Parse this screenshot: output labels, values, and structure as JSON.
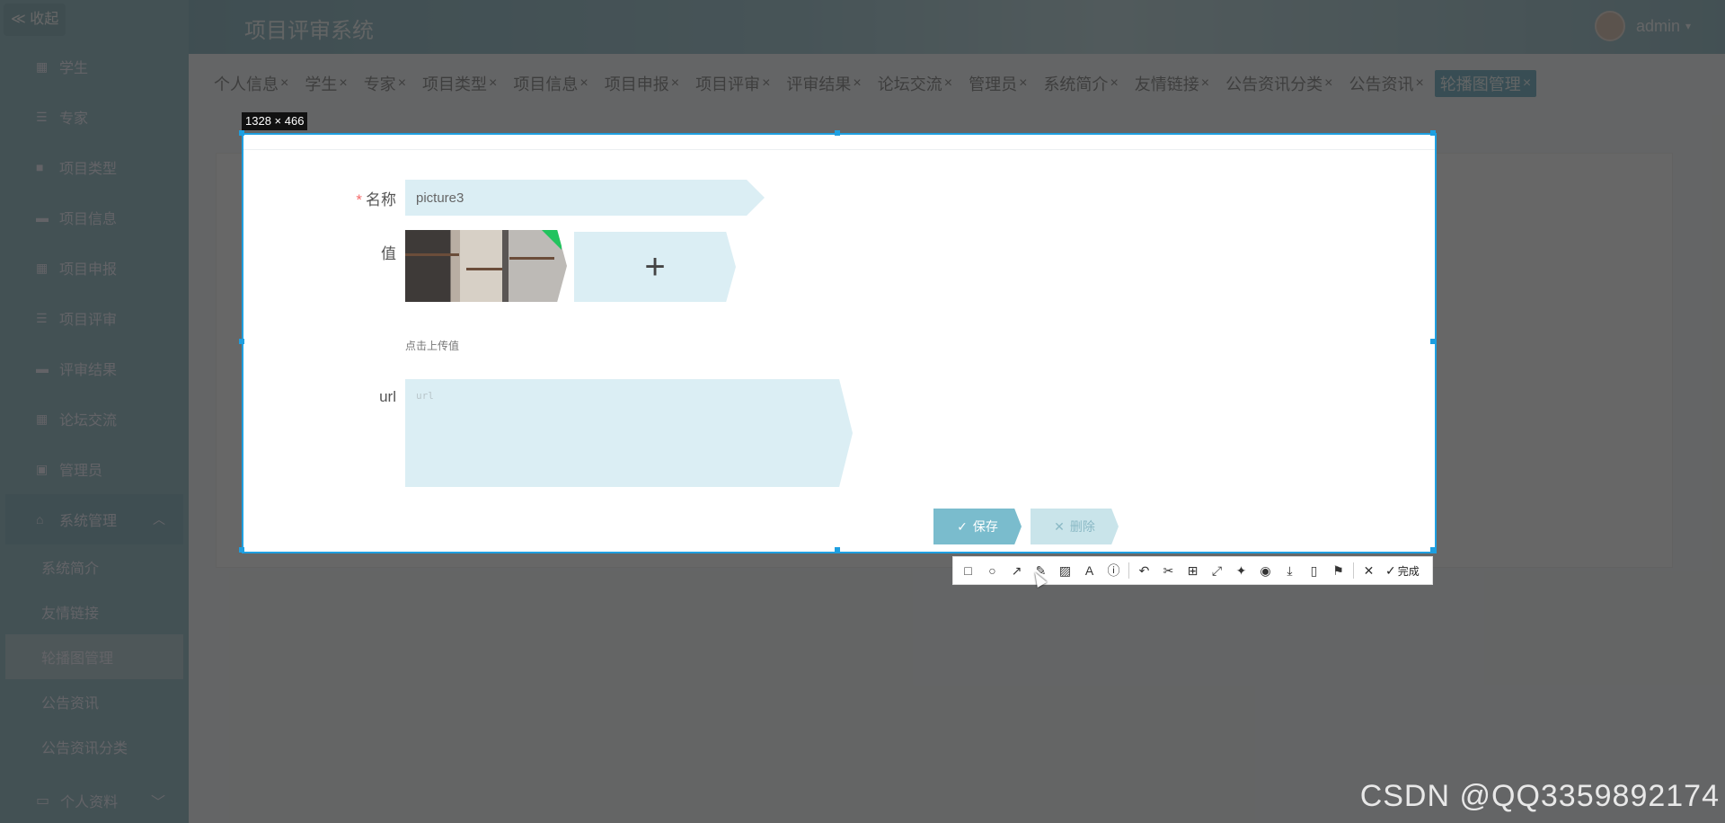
{
  "sidebar": {
    "collapse_label": "≪ 收起",
    "items": [
      {
        "label": "学生",
        "icon": "grid-icon"
      },
      {
        "label": "专家",
        "icon": "list-icon"
      },
      {
        "label": "项目类型",
        "icon": "briefcase-icon"
      },
      {
        "label": "项目信息",
        "icon": "monitor-icon"
      },
      {
        "label": "项目申报",
        "icon": "grid-icon"
      },
      {
        "label": "项目评审",
        "icon": "list-icon"
      },
      {
        "label": "评审结果",
        "icon": "comment-icon"
      },
      {
        "label": "论坛交流",
        "icon": "grid-icon"
      },
      {
        "label": "管理员",
        "icon": "clipboard-icon"
      }
    ],
    "group": {
      "label": "系统管理",
      "icon": "home-icon"
    },
    "sub_items": [
      {
        "label": "系统简介"
      },
      {
        "label": "友情链接"
      },
      {
        "label": "轮播图管理"
      },
      {
        "label": "公告资讯"
      },
      {
        "label": "公告资讯分类"
      }
    ],
    "bottom": {
      "label": "个人资料",
      "icon": "card-icon"
    }
  },
  "header": {
    "title": "项目评审系统",
    "user": "admin"
  },
  "tabs": [
    {
      "label": "个人信息"
    },
    {
      "label": "学生"
    },
    {
      "label": "专家"
    },
    {
      "label": "项目类型"
    },
    {
      "label": "项目信息"
    },
    {
      "label": "项目申报"
    },
    {
      "label": "项目评审"
    },
    {
      "label": "评审结果"
    },
    {
      "label": "论坛交流"
    },
    {
      "label": "管理员"
    },
    {
      "label": "系统简介"
    },
    {
      "label": "友情链接"
    },
    {
      "label": "公告资讯分类"
    },
    {
      "label": "公告资讯"
    },
    {
      "label": "轮播图管理"
    }
  ],
  "capture": {
    "size_label": "1328 × 466"
  },
  "form": {
    "name_label": "名称",
    "name_value": "picture3",
    "value_label": "值",
    "upload_hint": "点击上传值",
    "url_label": "url",
    "url_placeholder": "url",
    "save_label": "保存",
    "delete_label": "删除"
  },
  "toolbar": {
    "done_label": "完成"
  },
  "watermark": "CSDN @QQ3359892174"
}
